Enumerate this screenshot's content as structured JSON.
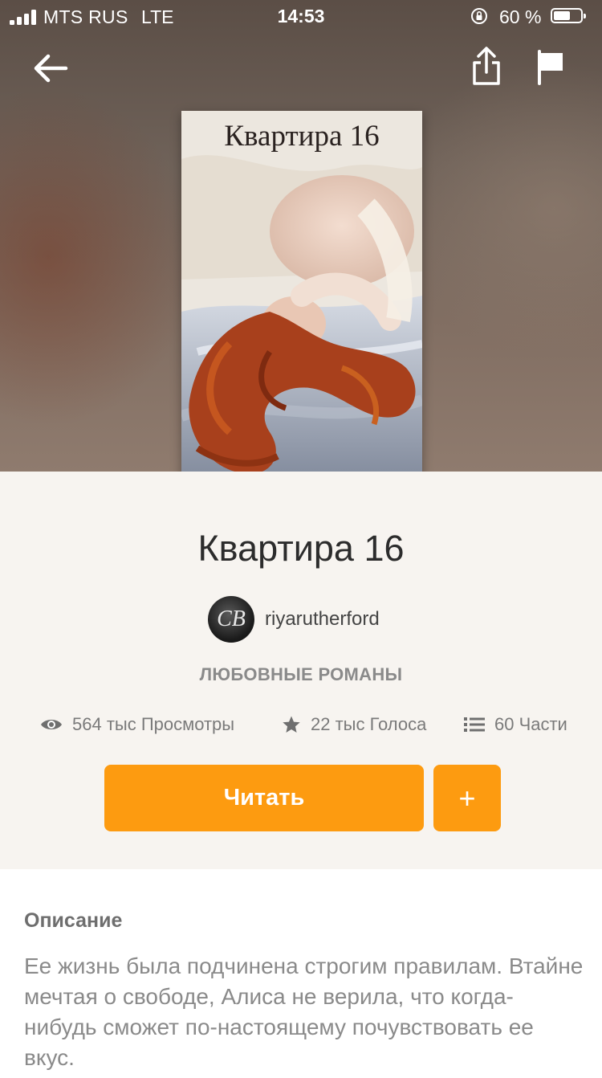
{
  "status_bar": {
    "carrier": "MTS RUS",
    "network": "LTE",
    "time": "14:53",
    "battery_percent": "60 %",
    "battery_level": 0.6
  },
  "nav": {
    "back_icon": "arrow-left-icon",
    "share_icon": "share-icon",
    "report_icon": "flag-icon"
  },
  "cover": {
    "title": "Квартира 16"
  },
  "book": {
    "title": "Квартира 16",
    "author": "riyarutherford",
    "avatar_text": "CB",
    "genre": "ЛЮБОВНЫЕ РОМАНЫ"
  },
  "stats": {
    "views": "564 тыс Просмотры",
    "votes": "22 тыс Голоса",
    "parts": "60 Части"
  },
  "actions": {
    "read_label": "Читать",
    "add_label": "+"
  },
  "description": {
    "heading": "Описание",
    "text": "Ее жизнь была подчинена строгим правилам. Втайне мечтая о свободе, Алиса не верила, что когда-нибудь сможет по-настоящему почувствовать ее вкус."
  },
  "colors": {
    "accent": "#fd9b10",
    "background": "#f7f4f0"
  }
}
